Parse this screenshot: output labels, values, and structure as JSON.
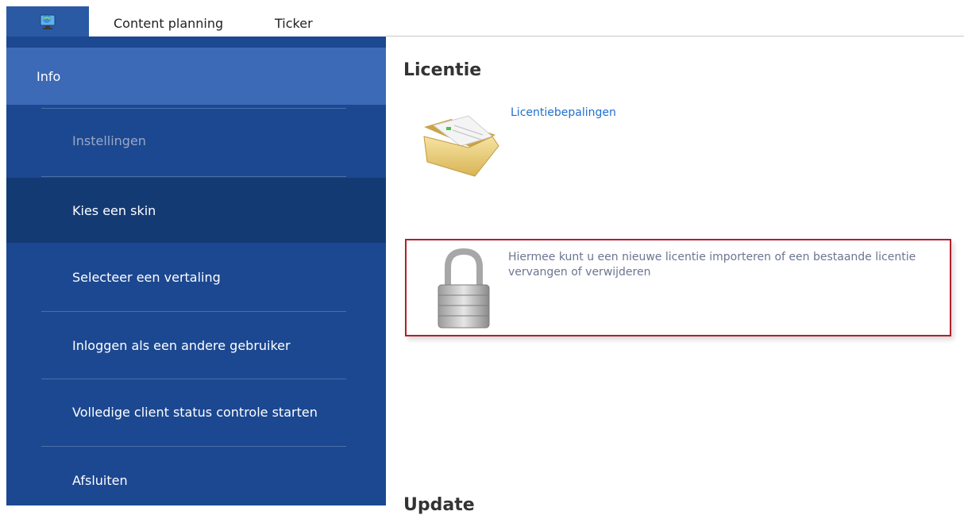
{
  "header": {
    "tabs": [
      {
        "label": "Content planning"
      },
      {
        "label": "Ticker"
      }
    ]
  },
  "sidebar": {
    "items": [
      {
        "label": "Info"
      },
      {
        "label": "Instellingen"
      },
      {
        "label": "Kies een skin"
      },
      {
        "label": "Selecteer een vertaling"
      },
      {
        "label": "Inloggen als een andere gebruiker"
      },
      {
        "label": "Volledige client status controle starten"
      },
      {
        "label": "Afsluiten"
      }
    ]
  },
  "main": {
    "section_title": "Licentie",
    "license_link": "Licentiebepalingen",
    "import_description": "Hiermee kunt u een nieuwe licentie importeren of een bestaande licentie vervangen of verwijderen",
    "next_section_title": "Update"
  },
  "colors": {
    "sidebar": "#1c4891",
    "sidebar_active": "#3d6ab7",
    "sidebar_hover": "#143a74",
    "link": "#1f6fd1",
    "highlight_border": "#b21f2d"
  },
  "icons": {
    "app": "monitor-globe-icon",
    "license_terms": "folder-icon",
    "import_license": "padlock-icon"
  }
}
